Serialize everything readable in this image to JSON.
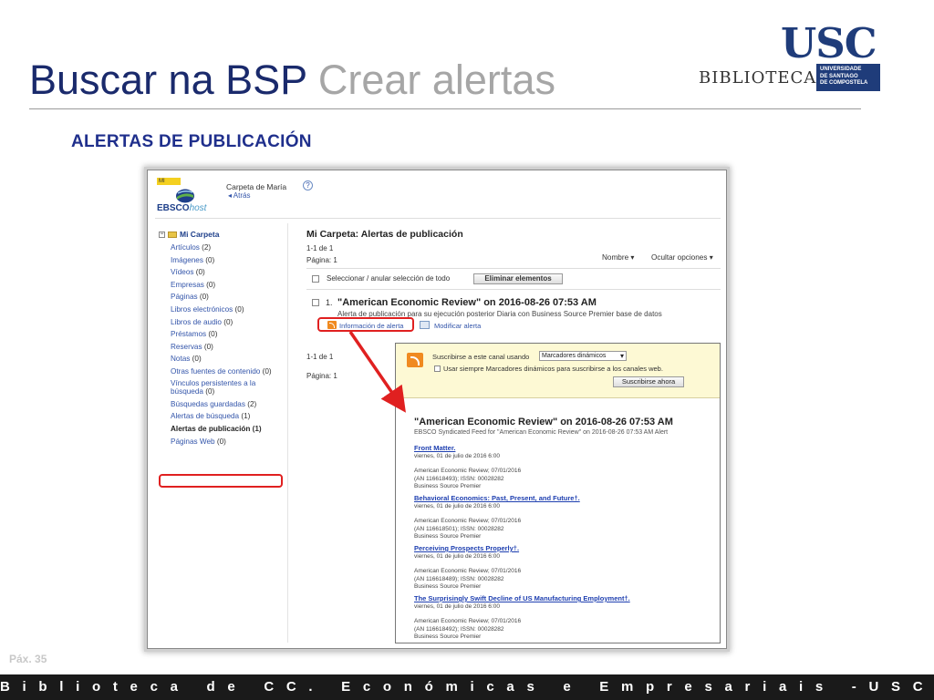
{
  "slide": {
    "title_main": "Buscar na BSP",
    "title_sub": "Crear alertas",
    "section_heading": "ALERTAS DE PUBLICACIÓN",
    "page_label": "Páx. 35",
    "footer": "Biblioteca de CC. Económicas e Empresariais -USC"
  },
  "logo": {
    "usc": "USC",
    "biblioteca": "BIBLIOTECA",
    "university": [
      "UNIVERSIDADE",
      "DE SANTIAGO",
      "DE COMPOSTELA"
    ]
  },
  "ebsco": {
    "badge": "MI",
    "brand_bold": "EBSCO",
    "brand_italic": "host",
    "folder_owner": "Carpeta de María",
    "back_link": "◂ Atrás",
    "help": "?"
  },
  "sidebar": {
    "root": "Mi Carpeta",
    "items": [
      {
        "label": "Artículos",
        "count": "(2)"
      },
      {
        "label": "Imágenes",
        "count": "(0)"
      },
      {
        "label": "Vídeos",
        "count": "(0)"
      },
      {
        "label": "Empresas",
        "count": "(0)"
      },
      {
        "label": "Páginas",
        "count": "(0)"
      },
      {
        "label": "Libros electrónicos",
        "count": "(0)"
      },
      {
        "label": "Libros de audio",
        "count": "(0)"
      },
      {
        "label": "Préstamos",
        "count": "(0)"
      },
      {
        "label": "Reservas",
        "count": "(0)"
      },
      {
        "label": "Notas",
        "count": "(0)"
      },
      {
        "label": "Otras fuentes de contenido",
        "count": "(0)"
      },
      {
        "label": "Vínculos persistentes a la búsqueda",
        "count": "(0)"
      },
      {
        "label": "Búsquedas guardadas",
        "count": "(2)"
      },
      {
        "label": "Alertas de búsqueda",
        "count": "(1)"
      },
      {
        "label": "Alertas de publicación",
        "count": "(1)"
      },
      {
        "label": "Páginas Web",
        "count": "(0)"
      }
    ]
  },
  "main": {
    "title": "Mi Carpeta: Alertas de publicación",
    "range_top": "1-1 de 1",
    "page_top": "Página: 1",
    "sort_label": "Nombre ▾",
    "options_label": "Ocultar opciones ▾",
    "select_all_label": "Seleccionar / anular selección de todo",
    "delete_button": "Eliminar elementos",
    "record_number": "1.",
    "record_title": "\"American Economic Review\" on 2016-08-26 07:53 AM",
    "record_desc": "Alerta de publicación para su ejecución posterior Diaria con Business Source Premier base de datos",
    "info_link": "Información de alerta",
    "edit_link": "Modificar alerta",
    "range_bottom": "1-1 de 1",
    "page_bottom": "Página: 1"
  },
  "feed": {
    "subscribe_label": "Suscribirse a este canal usando",
    "reader_select": "Marcadores dinámicos",
    "always_use_label": "Usar siempre Marcadores dinámicos para suscribirse a los canales web.",
    "subscribe_button": "Suscribirse ahora",
    "title": "\"American Economic Review\" on 2016-08-26 07:53 AM",
    "description": "EBSCO Syndicated Feed for \"American Economic Review\" on 2016-08-26 07:53 AM Alert",
    "items": [
      {
        "title": "Front Matter.",
        "date": "viernes, 01 de julio de 2016 6:00",
        "line1": "American Economic Review; 07/01/2016",
        "line2": "(AN 116618493); ISSN: 00028282",
        "line3": "Business Source Premier"
      },
      {
        "title": "Behavioral Economics: Past, Present, and Future†.",
        "date": "viernes, 01 de julio de 2016 6:00",
        "line1": "American Economic Review; 07/01/2016",
        "line2": "(AN 116618501); ISSN: 00028282",
        "line3": "Business Source Premier"
      },
      {
        "title": "Perceiving Prospects Properly†.",
        "date": "viernes, 01 de julio de 2016 6:00",
        "line1": "American Economic Review; 07/01/2016",
        "line2": "(AN 116618489); ISSN: 00028282",
        "line3": "Business Source Premier"
      },
      {
        "title": "The Surprisingly Swift Decline of US Manufacturing Employment†.",
        "date": "viernes, 01 de julio de 2016 6:00",
        "line1": "American Economic Review; 07/01/2016",
        "line2": "(AN 116618492); ISSN: 00028282",
        "line3": "Business Source Premier"
      }
    ]
  },
  "colors": {
    "title_blue": "#1a2a6c",
    "title_grey": "#a6a6a6",
    "heading_blue": "#1f2f8c",
    "highlight_red": "#e02020",
    "feed_header": "#fdf9d4",
    "footer_bg": "#1a1a1a"
  }
}
